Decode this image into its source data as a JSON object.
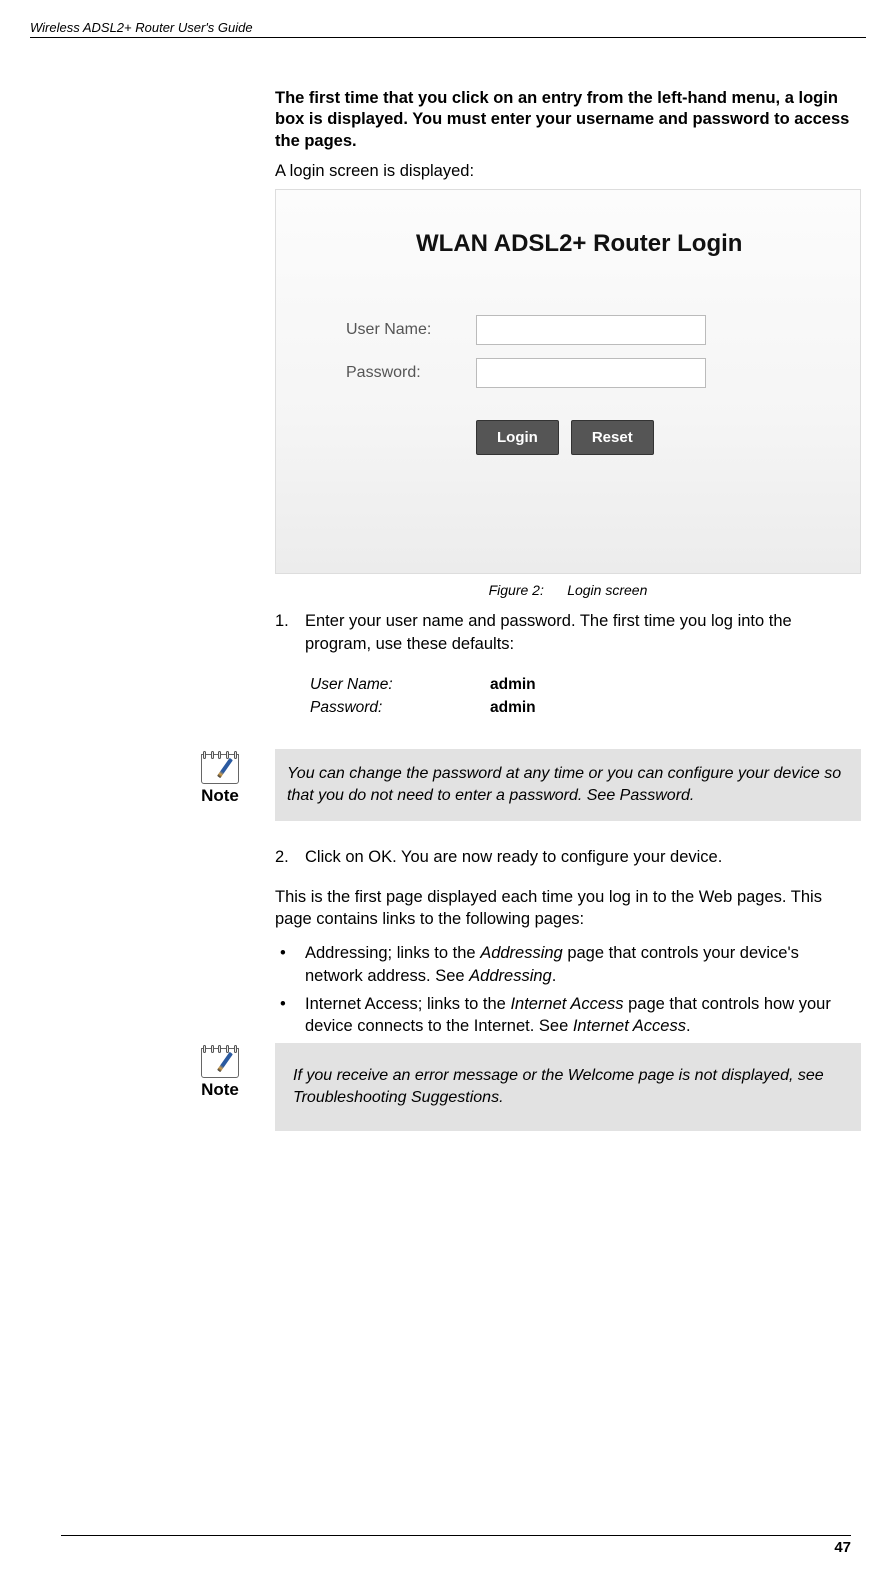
{
  "header": {
    "title": "Wireless ADSL2+ Router User's Guide"
  },
  "intro": {
    "bold": "The first time that you click on an entry from the left-hand menu, a login box is displayed. You must enter your username and password to access the pages.",
    "text": "A login screen is displayed:"
  },
  "login": {
    "title": "WLAN ADSL2+ Router Login",
    "username_label": "User Name:",
    "password_label": "Password:",
    "login_btn": "Login",
    "reset_btn": "Reset"
  },
  "figure": {
    "prefix": "Figure 2:",
    "caption": "Login screen"
  },
  "steps": {
    "s1_num": "1.",
    "s1_text": "Enter your user name and password. The first time you log into the program, use these defaults:",
    "s2_num": "2.",
    "s2_text": "Click on OK. You are now ready to configure your device."
  },
  "creds": {
    "username_label": "User Name:",
    "username_value": "admin",
    "password_label": "Password:",
    "password_value": "admin"
  },
  "notes": {
    "label": "Note",
    "n1_text": "You can change the password at any time or you can configure your device so that you do not need to enter a password. See Password.",
    "n2_text": "If you receive an error message or the Welcome page is not displayed, see Troubleshooting Suggestions."
  },
  "welcome": {
    "para": "This is the first page displayed each time you log in to the Web pages. This page contains links to the following pages:",
    "bullets": [
      {
        "pre": "Addressing; links to the ",
        "em1": "Addressing",
        "mid": " page that controls your device's network address. See ",
        "em2": "Addressing",
        "post": "."
      },
      {
        "pre": "Internet Access; links to the ",
        "em1": "Internet Access",
        "mid": " page that controls how your device connects to the Internet. See ",
        "em2": "Internet Access",
        "post": "."
      }
    ]
  },
  "page_number": "47"
}
